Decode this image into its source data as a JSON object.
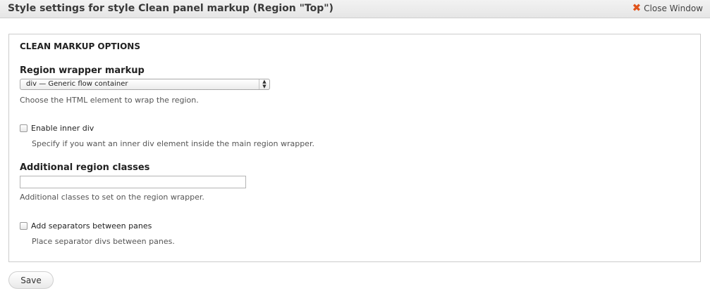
{
  "window": {
    "title": "Style settings for style Clean panel markup (Region \"Top\")",
    "close_label": "Close Window"
  },
  "fieldset": {
    "legend": "CLEAN MARKUP OPTIONS",
    "region_wrapper": {
      "label": "Region wrapper markup",
      "selected": "div — Generic flow container",
      "description": "Choose the HTML element to wrap the region."
    },
    "inner_div": {
      "label": "Enable inner div",
      "checked": false,
      "description": "Specify if you want an inner div element inside the main region wrapper."
    },
    "additional_classes": {
      "label": "Additional region classes",
      "value": "",
      "description": "Additional classes to set on the region wrapper."
    },
    "separators": {
      "label": "Add separators between panes",
      "checked": false,
      "description": "Place separator divs between panes."
    }
  },
  "actions": {
    "save_label": "Save"
  },
  "icons": {
    "close": "close-x-icon"
  },
  "colors": {
    "close_icon": "#e0531b"
  }
}
